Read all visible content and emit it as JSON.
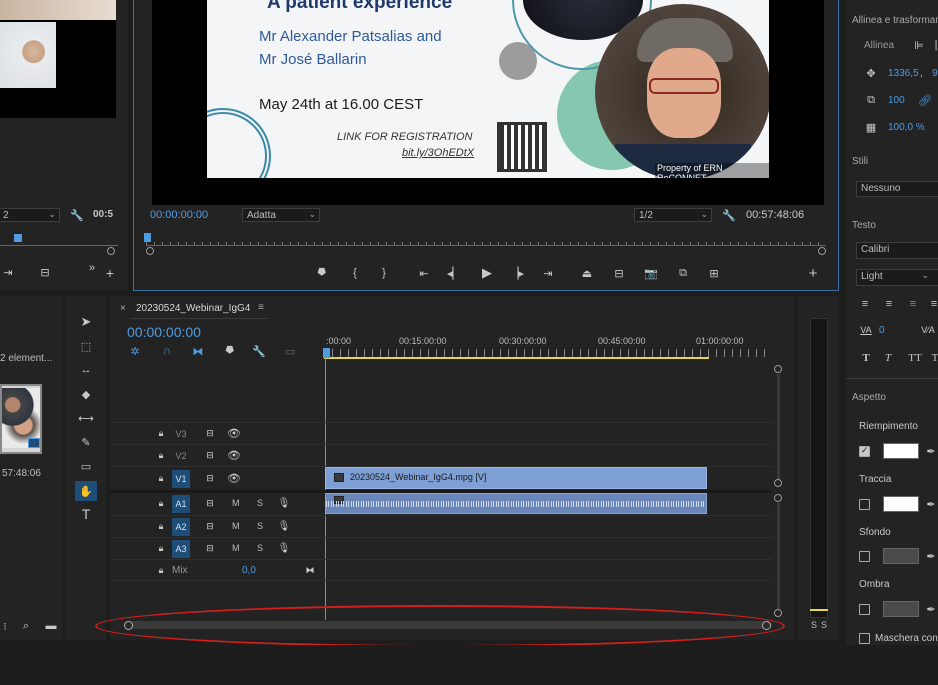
{
  "source_monitor": {
    "timecode": "00:5",
    "zoom_value": "2"
  },
  "program_monitor": {
    "slide": {
      "title": "A patient experience",
      "speakers_line1": "Mr Alexander Patsalias and",
      "speakers_line2": "Mr José Ballarin",
      "date": "May 24th at 16.00 CEST",
      "link_label": "LINK FOR REGISTRATION",
      "link_url": "bit.ly/3OhEDtX",
      "watermark": "Property of ERN ReCONNET"
    },
    "current_timecode": "00:00:00:00",
    "fit_select": "Adatta",
    "resolution_select": "1/2",
    "duration": "00:57:48:06"
  },
  "project_panel": {
    "items_label": "2 element...",
    "clip_duration": "57:48:06"
  },
  "timeline": {
    "sequence_name": "20230524_Webinar_IgG4",
    "timecode": "00:00:00:00",
    "ruler_labels": [
      ":00:00",
      "00:15:00:00",
      "00:30:00:00",
      "00:45:00:00",
      "01:00:00:00"
    ],
    "video_tracks": [
      {
        "id": "V3",
        "active": false
      },
      {
        "id": "V2",
        "active": false
      },
      {
        "id": "V1",
        "active": true
      }
    ],
    "audio_tracks": [
      {
        "id": "A1",
        "m": "M",
        "s": "S"
      },
      {
        "id": "A2",
        "m": "M",
        "s": "S"
      },
      {
        "id": "A3",
        "m": "M",
        "s": "S"
      }
    ],
    "mix_label": "Mix",
    "mix_value": "0,0",
    "video_clip_label": "20230524_Webinar_IgG4.mpg [V]"
  },
  "audio_meter": {
    "labels": [
      "S",
      "S"
    ]
  },
  "essential_graphics": {
    "align_header": "Allinea e trasformar",
    "align_label": "Allinea",
    "position_x": "1336,5",
    "position_sep": ",",
    "position_y": "9",
    "scale_value": "100",
    "opacity_value": "100,0 %",
    "styles_header": "Stili",
    "style_select": "Nessuno",
    "text_header": "Testo",
    "font_select": "Calibri",
    "font_style_select": "Light",
    "tracking_value": "0",
    "appearance_header": "Aspetto",
    "fill_label": "Riempimento",
    "stroke_label": "Traccia",
    "background_label": "Sfondo",
    "shadow_label": "Ombra",
    "mask_label": "Maschera con",
    "colors": {
      "fill": "#ffffff",
      "stroke": "#ffffff",
      "background": "#4a4a4a",
      "shadow": "#4a4a4a"
    }
  },
  "accent_colors": {
    "blue": "#4d9de0",
    "clip_video": "#7d9fd4",
    "clip_audio": "#6b86b8",
    "annotation": "#d0201e"
  }
}
